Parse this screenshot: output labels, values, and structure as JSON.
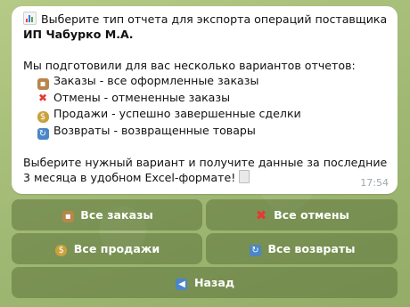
{
  "message": {
    "title_part1": "Выберите тип отчета для экспорта операций поставщика ",
    "title_bold": "ИП Чабурко М.А.",
    "intro": "Мы подготовили для вас несколько вариантов отчетов:",
    "options": [
      {
        "icon": "package-icon",
        "text": "Заказы - все оформленные заказы"
      },
      {
        "icon": "cross-mark-icon",
        "text": "Отмены - отмененные заказы"
      },
      {
        "icon": "money-bag-icon",
        "text": "Продажи - успешно завершенные сделки"
      },
      {
        "icon": "refresh-icon",
        "text": "Возвраты - возвращенные товары"
      }
    ],
    "footer": "Выберите нужный вариант и получите данные за последние 3 месяца в удобном Excel-формате!",
    "time": "17:54"
  },
  "keyboard": {
    "all_orders": "Все заказы",
    "all_cancellations": "Все отмены",
    "all_sales": "Все продажи",
    "all_returns": "Все возвраты",
    "back": "Назад"
  },
  "colors": {
    "chat_background": "#a9c07f",
    "bubble": "#ffffff",
    "button": "#6f8450"
  }
}
